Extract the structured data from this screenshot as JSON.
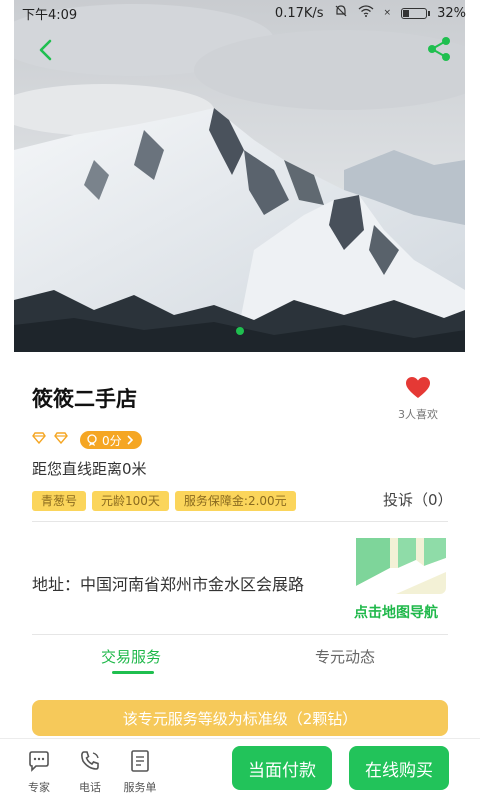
{
  "status_bar": {
    "time": "下午4:09",
    "network_speed": "0.17K/s",
    "battery_percent": "32%",
    "battery_level": 0.32
  },
  "hero": {
    "back_icon": "chevron-left-icon",
    "share_icon": "share-icon",
    "page_count": 1,
    "active_page": 1
  },
  "shop": {
    "name": "筱筱二手店",
    "likes": "3人喜欢",
    "diamond_icons": 2,
    "score": "0分",
    "distance": "距您直线距离0米",
    "tags": [
      "青葱号",
      "元龄100天",
      "服务保障金:2.00元"
    ],
    "complaints": "投诉（0）",
    "address": "地址：中国河南省郑州市金水区会展路",
    "map_nav": "点击地图导航"
  },
  "tabs": [
    {
      "label": "交易服务",
      "active": true
    },
    {
      "label": "专元动态",
      "active": false
    }
  ],
  "level_banner": "该专元服务等级为标准级（2颗钻）",
  "bottom_nav": [
    {
      "label": "专家",
      "icon": "chat-bubble-icon"
    },
    {
      "label": "电话",
      "icon": "phone-icon"
    },
    {
      "label": "服务单",
      "icon": "service-list-icon"
    }
  ],
  "actions": {
    "pay_in_person": "当面付款",
    "buy_online": "在线购买"
  },
  "colors": {
    "accent_green": "#1fbf4f",
    "badge_orange": "#f5a623",
    "tag_yellow": "#fbd55b",
    "banner_yellow": "#f6c95a",
    "heart_red": "#e53935"
  }
}
